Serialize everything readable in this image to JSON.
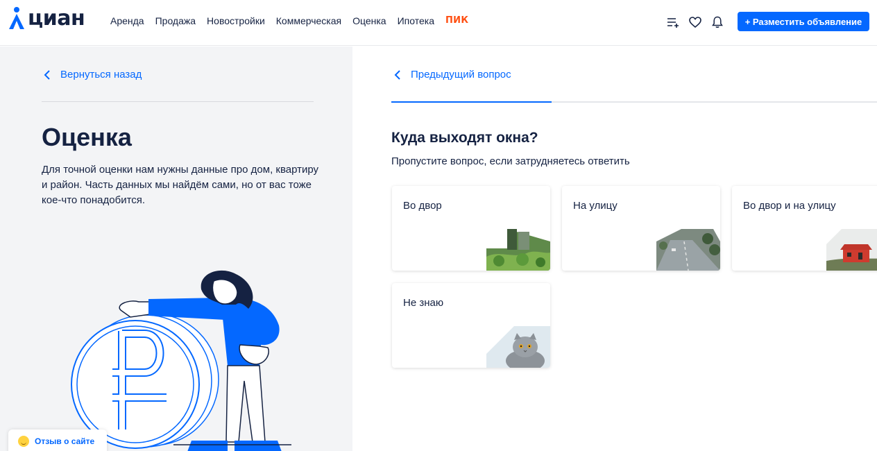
{
  "header": {
    "logo_text": "циан",
    "nav": [
      "Аренда",
      "Продажа",
      "Новостройки",
      "Коммерческая",
      "Оценка",
      "Ипотека"
    ],
    "pik": "ПИК",
    "place_button": "+ Разместить объявление",
    "icons": [
      "list-add-icon",
      "heart-icon",
      "bell-icon"
    ]
  },
  "left": {
    "back_link": "Вернуться назад",
    "title": "Оценка",
    "description": "Для точной оценки нам нужны данные про дом, квартиру и район. Часть данных мы найдём сами, но от вас тоже кое-что понадобится."
  },
  "feedback": {
    "label": "Отзыв о сайте"
  },
  "right": {
    "prev_question": "Предыдущий вопрос",
    "progress": 0.33,
    "question": "Куда выходят окна?",
    "hint": "Пропустите вопрос, если затрудняетесь ответить",
    "options": [
      {
        "label": "Во двор",
        "image": "courtyard-photo"
      },
      {
        "label": "На улицу",
        "image": "street-photo"
      },
      {
        "label": "Во двор и на улицу",
        "image": "house-photo"
      },
      {
        "label": "Не знаю",
        "image": "cat-photo"
      }
    ]
  },
  "colors": {
    "accent": "#0468ff",
    "text": "#152242",
    "pik": "#ff4f12",
    "left_bg": "#f3f4f6"
  }
}
